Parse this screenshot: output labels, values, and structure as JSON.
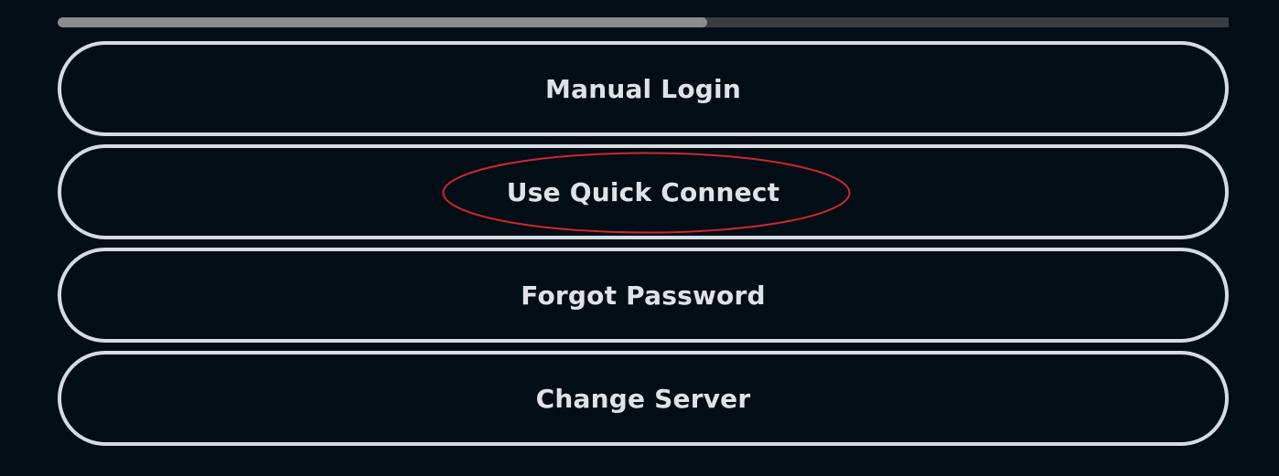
{
  "progress": {
    "fraction": 0.555,
    "fill_color": "#8b8d90",
    "track_color": "#3a3d41"
  },
  "buttons": [
    {
      "label": "Manual Login"
    },
    {
      "label": "Use Quick Connect"
    },
    {
      "label": "Forgot Password"
    },
    {
      "label": "Change Server"
    }
  ],
  "annotation": {
    "color": "#d0262e",
    "target": "Use Quick Connect"
  },
  "colors": {
    "background": "#020d16",
    "button_border": "#d5dbe1",
    "button_text": "#dfe3e8"
  }
}
